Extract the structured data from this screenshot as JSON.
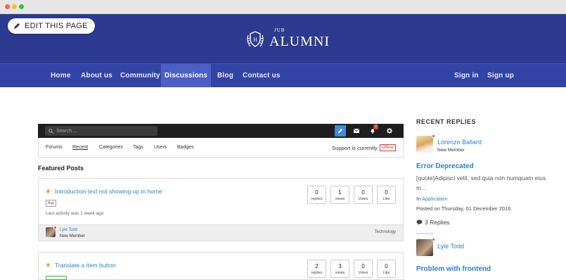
{
  "header": {
    "edit_button": "EDIT THIS PAGE",
    "logo_small": "JUB",
    "logo_main": "ALUMNI"
  },
  "nav": {
    "items": [
      "Home",
      "About us",
      "Community",
      "Discussions",
      "Blog",
      "Contact us"
    ],
    "active": "Discussions",
    "sign_in": "Sign in",
    "sign_up": "Sign up"
  },
  "forum": {
    "search_placeholder": "Search ...",
    "notification_count": "2",
    "tabs": [
      "Forums",
      "Recent",
      "Categories",
      "Tags",
      "Users",
      "Badges"
    ],
    "active_tab": "Recent",
    "support_label": "Support is currently",
    "support_status": "Offline",
    "featured_heading": "Featured Posts",
    "posts": [
      {
        "title": "Introduction text not showing up in home",
        "tag": "Bug",
        "activity": "Last activity was 1 week ago",
        "stats": [
          {
            "num": "0",
            "label": "replies"
          },
          {
            "num": "1",
            "label": "views"
          },
          {
            "num": "0",
            "label": "Votes"
          },
          {
            "num": "0",
            "label": "Like"
          }
        ],
        "author": "Lyle Todd",
        "author_role": "New Member",
        "category": "Technology"
      },
      {
        "title": "Translate a item button",
        "stats": [
          {
            "num": "2",
            "label": "replies"
          },
          {
            "num": "3",
            "label": "views"
          },
          {
            "num": "0",
            "label": "Votes"
          },
          {
            "num": "0",
            "label": "Like"
          }
        ]
      }
    ]
  },
  "sidebar": {
    "heading": "RECENT REPLIES",
    "replies": [
      {
        "name": "Lorenzo Ballard",
        "role": "New Member",
        "title": "Error Deprecated",
        "excerpt": "[quote]Adipisci velit, sed quia non numquam eius m...",
        "in_label": "In",
        "category": "Application",
        "posted": "Posted on Thursday, 01 December 2016",
        "replies": "3 Replies"
      },
      {
        "name": "Lyle Todd",
        "title": "Problem with frontend"
      }
    ]
  },
  "colors": {
    "header_bg": "#2c3a8f",
    "nav_bg": "#3344a6",
    "nav_active": "#4d5fc4",
    "link": "#2f7fc9",
    "offline": "#d43f3a"
  }
}
